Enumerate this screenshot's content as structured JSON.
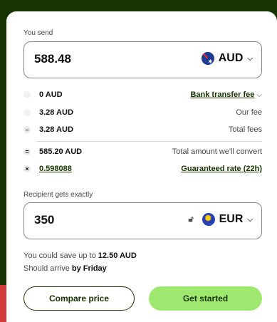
{
  "send": {
    "label": "You send",
    "amount": "588.48",
    "currency": "AUD",
    "flag_icon": "australia-flag-icon"
  },
  "fees": [
    {
      "amount": "0 AUD",
      "label": "Bank transfer fee",
      "marker": ""
    },
    {
      "amount": "3.28 AUD",
      "label": "Our fee",
      "marker": ""
    },
    {
      "amount": "3.28 AUD",
      "label": "Total fees",
      "marker": "–"
    },
    {
      "amount": "585.20 AUD",
      "label": "Total amount we'll convert",
      "marker": "="
    },
    {
      "amount": "0.598088",
      "label": "Guaranteed rate (22h)",
      "marker": "×"
    }
  ],
  "receive": {
    "label": "Recipient gets exactly",
    "amount": "350",
    "currency": "EUR",
    "flag_icon": "eu-flag-icon"
  },
  "savings": {
    "prefix": "You could save up to ",
    "amount": "12.50 AUD",
    "arrival_prefix": "Should arrive ",
    "arrival": "by Friday"
  },
  "buttons": {
    "compare": "Compare price",
    "start": "Get started"
  },
  "colors": {
    "brand_dark": "#163300",
    "brand_green": "#9fe870"
  }
}
